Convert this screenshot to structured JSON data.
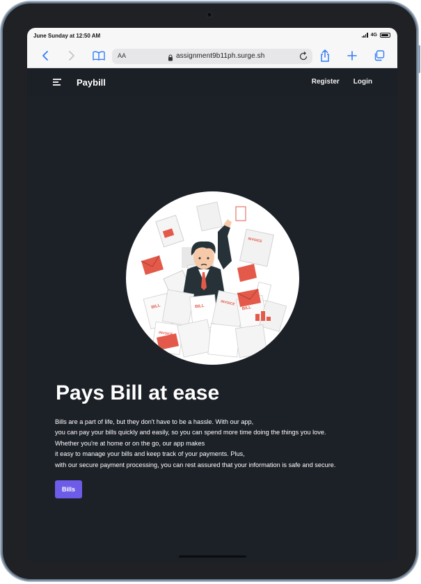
{
  "status_bar": {
    "time": "June Sunday at 12:50 AM",
    "network": "4G"
  },
  "browser": {
    "text_size_label": "AA",
    "url": "assignment9b11ph.surge.sh"
  },
  "navbar": {
    "brand": "Paybill",
    "links": [
      "Register",
      "Login"
    ]
  },
  "hero": {
    "headline": "Pays Bill at ease",
    "paragraph_lines": [
      "Bills are a part of life, but they don't have to be a hassle. With our app,",
      "you can pay your bills quickly and easily, so you can spend more time doing the things you love.",
      "Whether you're at home or on the go, our app makes",
      "it easy to manage your bills and keep track of your payments. Plus,",
      "with our secure payment processing, you can rest assured that your information is safe and secure."
    ],
    "cta_label": "Bills",
    "illustration_labels": [
      "INVOICE",
      "BILL",
      "INVOICE",
      "BILL",
      "INVOICE",
      "BILL"
    ]
  },
  "colors": {
    "page_bg": "#1c2027",
    "accent": "#6c5ce7",
    "illustration_red": "#e35a4a"
  }
}
